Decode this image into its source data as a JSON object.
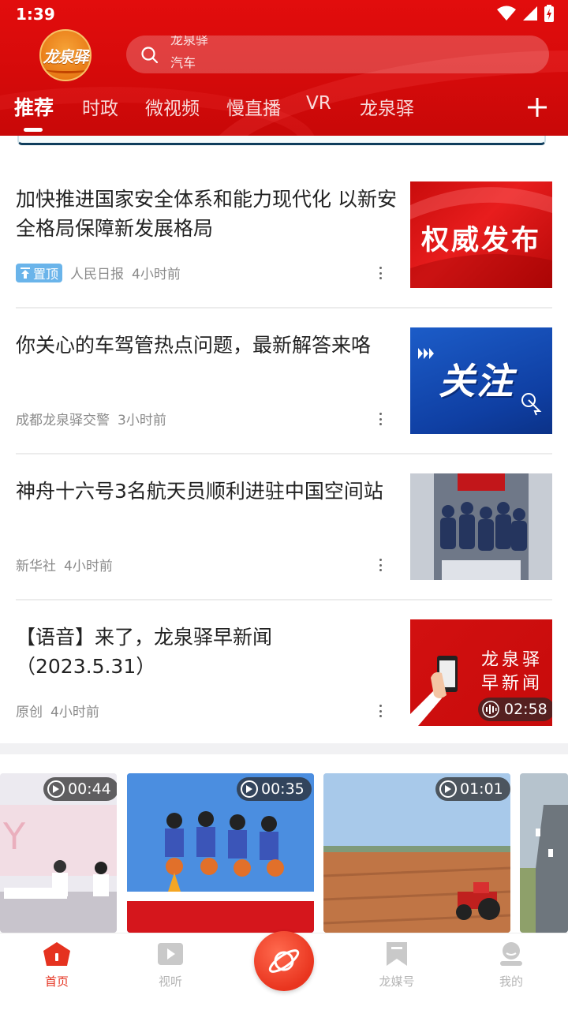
{
  "status_bar": {
    "time": "1:39"
  },
  "header": {
    "logo_text": "龙泉驿",
    "search": {
      "rotating_prev": "龙泉驿",
      "placeholder": "汽车"
    },
    "tabs": [
      "推荐",
      "时政",
      "微视频",
      "慢直播",
      "VR",
      "龙泉驿"
    ],
    "active_tab_index": 0
  },
  "news": [
    {
      "title": "加快推进国家安全体系和能力现代化 以新安全格局保障新发展格局",
      "badge": "置顶",
      "source": "人民日报",
      "time": "4小时前",
      "thumb_text": "权威发布"
    },
    {
      "title": "你关心的车驾管热点问题，最新解答来咯",
      "source": "成都龙泉驿交警",
      "time": "3小时前",
      "thumb_text": "关注"
    },
    {
      "title": "神舟十六号3名航天员顺利进驻中国空间站",
      "source": "新华社",
      "time": "4小时前"
    },
    {
      "title": "【语音】来了，龙泉驿早新闻（2023.5.31）",
      "source": "原创",
      "time": "4小时前",
      "thumb_line1": "龙泉驿",
      "thumb_line2": "早新闻",
      "audio_duration": "02:58"
    }
  ],
  "videos": [
    {
      "duration": "00:44"
    },
    {
      "duration": "00:35"
    },
    {
      "duration": "01:01"
    }
  ],
  "bottom_nav": {
    "items": [
      "首页",
      "视听",
      "龙媒号",
      "我的"
    ],
    "active_index": 0
  },
  "colors": {
    "brand_red": "#d40a0a",
    "accent": "#e5321f",
    "badge_blue": "#6ab4ea"
  }
}
